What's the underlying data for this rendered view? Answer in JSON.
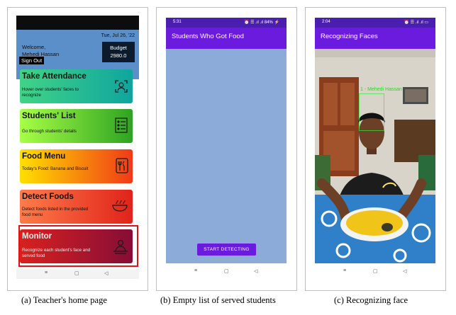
{
  "panel_a": {
    "header": {
      "welcome": "Welcome,",
      "user_name": "Mehedi Hassan",
      "date": "Tue, Jul 26, '22",
      "budget_label": "Budget",
      "budget_value": "2980.0",
      "sign_out": "Sign Out",
      "color": "#5b8fc9"
    },
    "cards": [
      {
        "title": "Take Attendance",
        "desc": "Hover over students' faces to recognize",
        "icon": "face-scan-icon"
      },
      {
        "title": "Students' List",
        "desc": "Go through students' details",
        "icon": "student-list-icon"
      },
      {
        "title": "Food Menu",
        "desc": "Today's Food: Banana and Biscuit",
        "icon": "food-menu-icon"
      },
      {
        "title": "Detect Foods",
        "desc": "Detect foods listed in the provided food menu",
        "icon": "food-bowl-icon"
      },
      {
        "title": "Monitor",
        "desc": "Recognize each student's face and served food",
        "icon": "monitor-person-icon"
      }
    ],
    "caption": "(a) Teacher's home page"
  },
  "panel_b": {
    "status_time": "5:31",
    "status_icons": "⏰ ☰ .ıl .ıl 84% ⚡",
    "title": "Students Who Got Food",
    "button": "START DETECTING",
    "colors": {
      "appbar": "#6a1bde",
      "list": "#8cabd8"
    },
    "caption": "(b) Empty list of served students"
  },
  "panel_c": {
    "status_time": "2:04",
    "status_icons": "⏰ ☰ .ıl .ıl ▭",
    "title": "Recognizing Faces",
    "face_label": "1 - Mehedi Hassan",
    "caption": "(c) Recognizing face"
  },
  "nav": {
    "back": "◁",
    "home": "▢",
    "recents": "≡"
  }
}
